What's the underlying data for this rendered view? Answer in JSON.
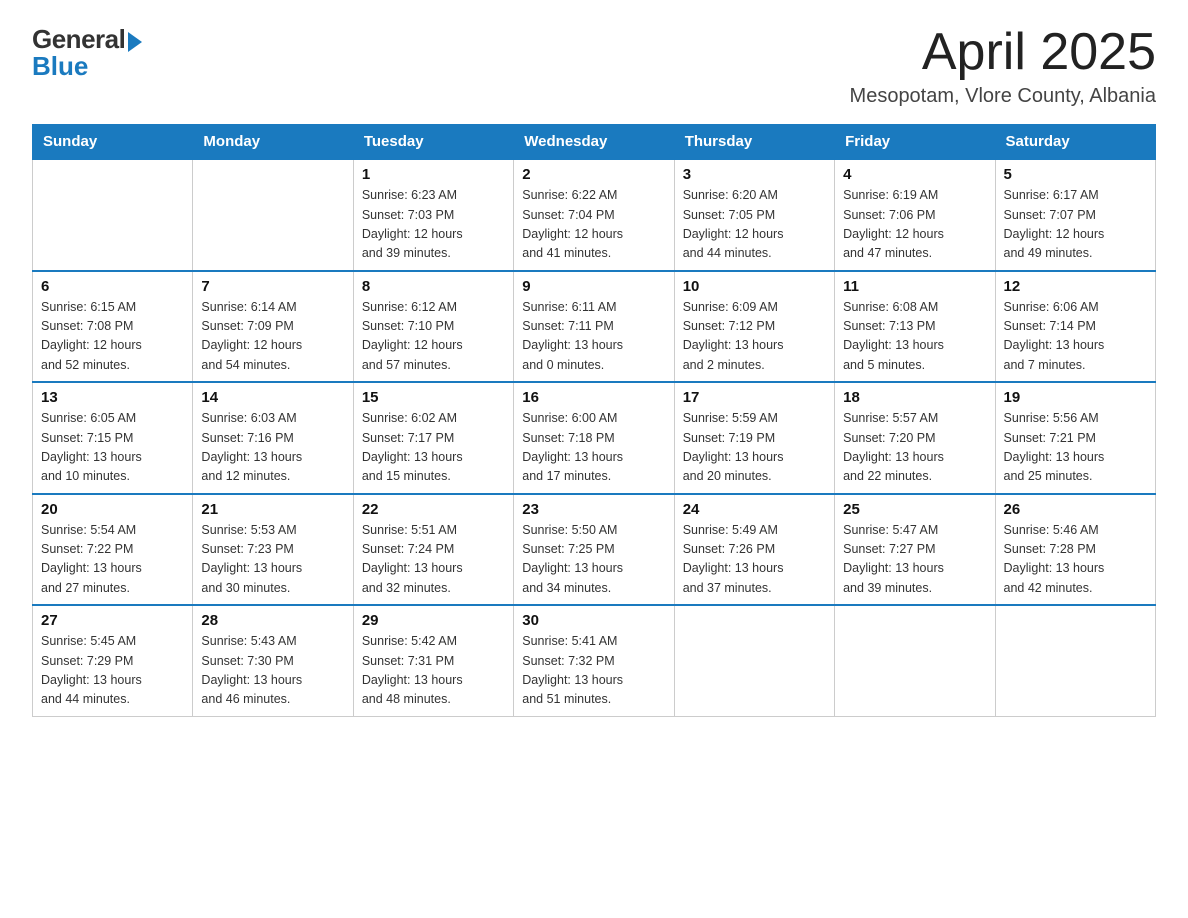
{
  "logo": {
    "general": "General",
    "blue": "Blue"
  },
  "header": {
    "month": "April 2025",
    "location": "Mesopotam, Vlore County, Albania"
  },
  "days_of_week": [
    "Sunday",
    "Monday",
    "Tuesday",
    "Wednesday",
    "Thursday",
    "Friday",
    "Saturday"
  ],
  "weeks": [
    [
      {
        "day": "",
        "info": ""
      },
      {
        "day": "",
        "info": ""
      },
      {
        "day": "1",
        "info": "Sunrise: 6:23 AM\nSunset: 7:03 PM\nDaylight: 12 hours\nand 39 minutes."
      },
      {
        "day": "2",
        "info": "Sunrise: 6:22 AM\nSunset: 7:04 PM\nDaylight: 12 hours\nand 41 minutes."
      },
      {
        "day": "3",
        "info": "Sunrise: 6:20 AM\nSunset: 7:05 PM\nDaylight: 12 hours\nand 44 minutes."
      },
      {
        "day": "4",
        "info": "Sunrise: 6:19 AM\nSunset: 7:06 PM\nDaylight: 12 hours\nand 47 minutes."
      },
      {
        "day": "5",
        "info": "Sunrise: 6:17 AM\nSunset: 7:07 PM\nDaylight: 12 hours\nand 49 minutes."
      }
    ],
    [
      {
        "day": "6",
        "info": "Sunrise: 6:15 AM\nSunset: 7:08 PM\nDaylight: 12 hours\nand 52 minutes."
      },
      {
        "day": "7",
        "info": "Sunrise: 6:14 AM\nSunset: 7:09 PM\nDaylight: 12 hours\nand 54 minutes."
      },
      {
        "day": "8",
        "info": "Sunrise: 6:12 AM\nSunset: 7:10 PM\nDaylight: 12 hours\nand 57 minutes."
      },
      {
        "day": "9",
        "info": "Sunrise: 6:11 AM\nSunset: 7:11 PM\nDaylight: 13 hours\nand 0 minutes."
      },
      {
        "day": "10",
        "info": "Sunrise: 6:09 AM\nSunset: 7:12 PM\nDaylight: 13 hours\nand 2 minutes."
      },
      {
        "day": "11",
        "info": "Sunrise: 6:08 AM\nSunset: 7:13 PM\nDaylight: 13 hours\nand 5 minutes."
      },
      {
        "day": "12",
        "info": "Sunrise: 6:06 AM\nSunset: 7:14 PM\nDaylight: 13 hours\nand 7 minutes."
      }
    ],
    [
      {
        "day": "13",
        "info": "Sunrise: 6:05 AM\nSunset: 7:15 PM\nDaylight: 13 hours\nand 10 minutes."
      },
      {
        "day": "14",
        "info": "Sunrise: 6:03 AM\nSunset: 7:16 PM\nDaylight: 13 hours\nand 12 minutes."
      },
      {
        "day": "15",
        "info": "Sunrise: 6:02 AM\nSunset: 7:17 PM\nDaylight: 13 hours\nand 15 minutes."
      },
      {
        "day": "16",
        "info": "Sunrise: 6:00 AM\nSunset: 7:18 PM\nDaylight: 13 hours\nand 17 minutes."
      },
      {
        "day": "17",
        "info": "Sunrise: 5:59 AM\nSunset: 7:19 PM\nDaylight: 13 hours\nand 20 minutes."
      },
      {
        "day": "18",
        "info": "Sunrise: 5:57 AM\nSunset: 7:20 PM\nDaylight: 13 hours\nand 22 minutes."
      },
      {
        "day": "19",
        "info": "Sunrise: 5:56 AM\nSunset: 7:21 PM\nDaylight: 13 hours\nand 25 minutes."
      }
    ],
    [
      {
        "day": "20",
        "info": "Sunrise: 5:54 AM\nSunset: 7:22 PM\nDaylight: 13 hours\nand 27 minutes."
      },
      {
        "day": "21",
        "info": "Sunrise: 5:53 AM\nSunset: 7:23 PM\nDaylight: 13 hours\nand 30 minutes."
      },
      {
        "day": "22",
        "info": "Sunrise: 5:51 AM\nSunset: 7:24 PM\nDaylight: 13 hours\nand 32 minutes."
      },
      {
        "day": "23",
        "info": "Sunrise: 5:50 AM\nSunset: 7:25 PM\nDaylight: 13 hours\nand 34 minutes."
      },
      {
        "day": "24",
        "info": "Sunrise: 5:49 AM\nSunset: 7:26 PM\nDaylight: 13 hours\nand 37 minutes."
      },
      {
        "day": "25",
        "info": "Sunrise: 5:47 AM\nSunset: 7:27 PM\nDaylight: 13 hours\nand 39 minutes."
      },
      {
        "day": "26",
        "info": "Sunrise: 5:46 AM\nSunset: 7:28 PM\nDaylight: 13 hours\nand 42 minutes."
      }
    ],
    [
      {
        "day": "27",
        "info": "Sunrise: 5:45 AM\nSunset: 7:29 PM\nDaylight: 13 hours\nand 44 minutes."
      },
      {
        "day": "28",
        "info": "Sunrise: 5:43 AM\nSunset: 7:30 PM\nDaylight: 13 hours\nand 46 minutes."
      },
      {
        "day": "29",
        "info": "Sunrise: 5:42 AM\nSunset: 7:31 PM\nDaylight: 13 hours\nand 48 minutes."
      },
      {
        "day": "30",
        "info": "Sunrise: 5:41 AM\nSunset: 7:32 PM\nDaylight: 13 hours\nand 51 minutes."
      },
      {
        "day": "",
        "info": ""
      },
      {
        "day": "",
        "info": ""
      },
      {
        "day": "",
        "info": ""
      }
    ]
  ]
}
